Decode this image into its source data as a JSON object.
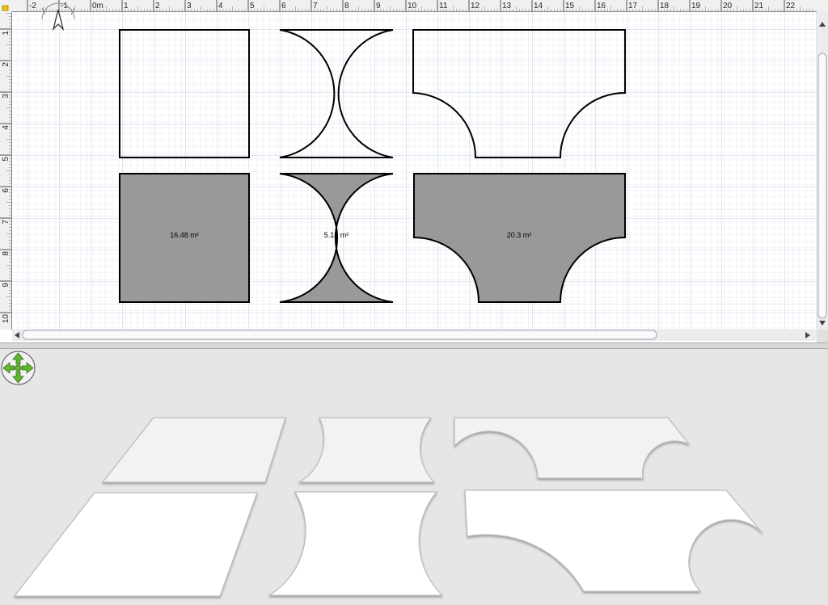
{
  "plan": {
    "ruler": {
      "x_labels": [
        "-2",
        "-1",
        "0m",
        "1",
        "2",
        "3",
        "4",
        "5",
        "6",
        "7",
        "8",
        "9",
        "10",
        "11",
        "12",
        "13",
        "14",
        "15",
        "16",
        "17",
        "18",
        "19",
        "20",
        "21",
        "22"
      ],
      "y_labels": [
        "1",
        "2",
        "3",
        "4",
        "5",
        "6",
        "7",
        "8",
        "9",
        "10"
      ]
    },
    "rooms": [
      {
        "shape": "rectangle",
        "filled": false,
        "area_label": ""
      },
      {
        "shape": "hourglass",
        "filled": false,
        "area_label": ""
      },
      {
        "shape": "notched",
        "filled": false,
        "area_label": ""
      },
      {
        "shape": "rectangle",
        "filled": true,
        "area_label": "16.48 m²"
      },
      {
        "shape": "hourglass",
        "filled": true,
        "area_label": "5.18 m²"
      },
      {
        "shape": "notched",
        "filled": true,
        "area_label": "20.3 m²"
      }
    ],
    "colors": {
      "room_fill": "#999999",
      "grid_minor": "#e4e9f2",
      "grid_major": "#c5cfe0",
      "ruler_bg": "#f0f0f0"
    }
  },
  "view3d": {
    "navigation_icon": "navigation-arrows-icon",
    "colors": {
      "background": "#e6e6e6",
      "floor": "#ffffff",
      "accent": "#62b531"
    }
  },
  "icons": [
    "compass-icon",
    "navigation-arrows-icon"
  ]
}
